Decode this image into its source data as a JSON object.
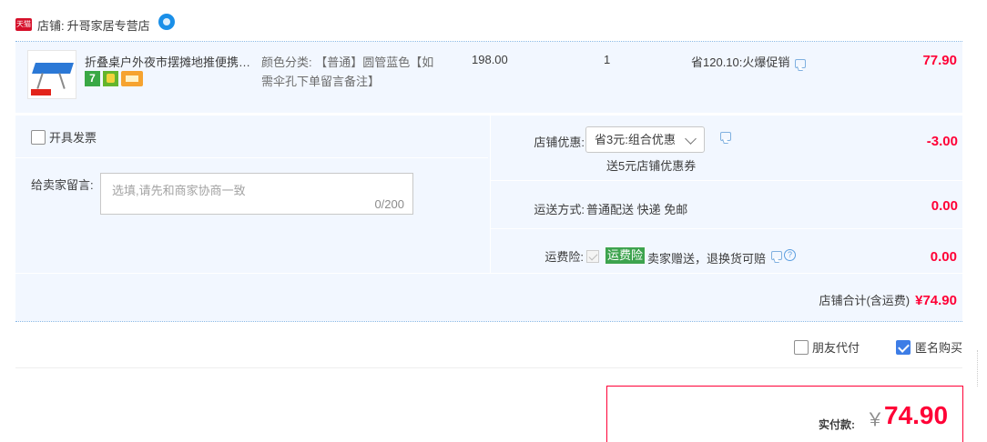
{
  "shop": {
    "badge": "天猫",
    "label": "店铺:",
    "name": "升哥家居专营店"
  },
  "item": {
    "title": "折叠桌户外夜市摆摊地推便携式...",
    "badge_7": "7",
    "sku_label": "颜色分类:",
    "sku_value": "【普通】圆管蓝色【如需伞孔下单留言备注】",
    "price": "198.00",
    "quantity": "1",
    "promo": "省120.10:火爆促销",
    "subtotal": "77.90"
  },
  "options": {
    "invoice_label": "开具发票",
    "message_label": "给卖家留言:",
    "message_placeholder": "选填,请先和商家协商一致",
    "message_count": "0/200",
    "coupon_label": "店铺优惠:",
    "coupon_selected": "省3元:组合优惠",
    "coupon_note": "送5元店铺优惠券",
    "coupon_value": "-3.00",
    "shipping_label": "运送方式:",
    "shipping_method": "普通配送 快递 免邮",
    "shipping_value": "0.00",
    "insurance_label": "运费险:",
    "insurance_tag": "运费险",
    "insurance_text": "卖家赠送，退换货可赔",
    "insurance_help": "?",
    "insurance_value": "0.00",
    "store_total_label": "店铺合计(含运费)",
    "store_total_value": "¥74.90"
  },
  "checkout": {
    "friend_pay_label": "朋友代付",
    "anonymous_label": "匿名购买",
    "pay_label": "实付款:",
    "pay_currency": "￥",
    "pay_amount": "74.90"
  },
  "colors": {
    "accent_red": "#ff0036",
    "row_bg": "#f2f7ff",
    "checkbox_blue": "#3d7de6",
    "insurance_green": "#3da34e"
  }
}
